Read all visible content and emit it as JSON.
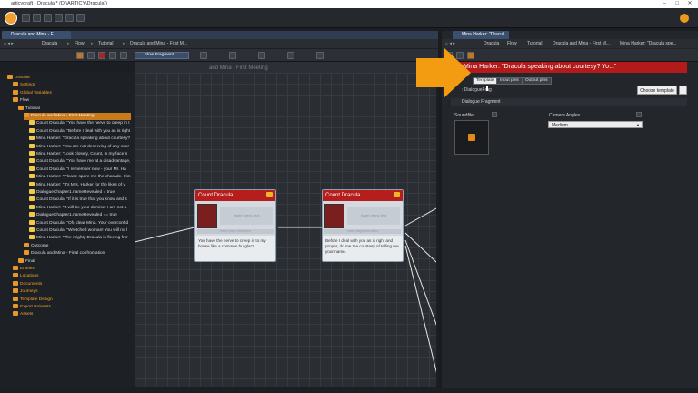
{
  "window": {
    "title": "articydraft - Dracula * (D:\\ARTICY\\Dracula\\)"
  },
  "left_panel": {
    "tab": "Dracula and Mina - F...",
    "breadcrumb": [
      "Dracula",
      "Flow",
      "Tutorial",
      "Dracula and Mina - First M..."
    ],
    "flow_fragment_label": "Flow Fragment",
    "canvas_title_partial": "and Mina - First Meeting"
  },
  "tree": [
    {
      "label": "Dracula",
      "color": "orange",
      "indent": 0
    },
    {
      "label": "Settings",
      "color": "orange",
      "indent": 1
    },
    {
      "label": "Global Variables",
      "color": "orange",
      "indent": 1
    },
    {
      "label": "Flow",
      "color": "white",
      "indent": 1
    },
    {
      "label": "Tutorial",
      "color": "white",
      "indent": 2
    },
    {
      "label": "Dracula and Mina - First Meeting",
      "color": "white",
      "indent": 3,
      "selected": true
    },
    {
      "label": "Count Dracula: \"You have the nerve to creep in t",
      "color": "white",
      "indent": 4
    },
    {
      "label": "Count Dracula: \"Before I deal with you as is right",
      "color": "white",
      "indent": 4
    },
    {
      "label": "Mina Harker: \"Dracula speaking about courtesy?",
      "color": "white",
      "indent": 4
    },
    {
      "label": "Mina Harker: \"You are not deserving of any cour",
      "color": "white",
      "indent": 4
    },
    {
      "label": "Mina Harker: \"Look closely, Count, is my face n",
      "color": "white",
      "indent": 4
    },
    {
      "label": "Count Dracula: \"You have me at a disadvantage,",
      "color": "white",
      "indent": 4
    },
    {
      "label": "Count Dracula: \"I remember now - your Mr. Ha",
      "color": "white",
      "indent": 4
    },
    {
      "label": "Mina Harker: \"Please spare me the charade. I kn",
      "color": "white",
      "indent": 4
    },
    {
      "label": "Mina Harker: \"It's Mrs. Harker for the likes of y",
      "color": "white",
      "indent": 4
    },
    {
      "label": "DialogueChapter1.nameRevealed = true",
      "color": "white",
      "indent": 4
    },
    {
      "label": "Count Dracula: \"If it is true that you know and s",
      "color": "white",
      "indent": 4
    },
    {
      "label": "Mina Harker: \"It will be your demise! I am not a",
      "color": "white",
      "indent": 4
    },
    {
      "label": "DialogueChapter1.nameRevealed == true",
      "color": "white",
      "indent": 4
    },
    {
      "label": "Count Dracula: \"Oh, dear Mina. Your overconfid",
      "color": "white",
      "indent": 4
    },
    {
      "label": "Count Dracula: \"Wretched woman! You will no l",
      "color": "white",
      "indent": 4
    },
    {
      "label": "Mina Harker: \"The mighty Dracula is fleeing fror",
      "color": "white",
      "indent": 4
    },
    {
      "label": "Outcome",
      "color": "white",
      "indent": 3
    },
    {
      "label": "Dracula and Mina - Final confrontation",
      "color": "white",
      "indent": 3
    },
    {
      "label": "Final",
      "color": "white",
      "indent": 2
    },
    {
      "label": "Entities",
      "color": "orange",
      "indent": 1
    },
    {
      "label": "Locations",
      "color": "orange",
      "indent": 1
    },
    {
      "label": "Documents",
      "color": "orange",
      "indent": 1
    },
    {
      "label": "Journeys",
      "color": "orange",
      "indent": 1
    },
    {
      "label": "Template Design",
      "color": "orange",
      "indent": 1
    },
    {
      "label": "Export Rulesets",
      "color": "orange",
      "indent": 1
    },
    {
      "label": "Assets",
      "color": "orange",
      "indent": 1
    }
  ],
  "nodes": [
    {
      "speaker": "Count Dracula",
      "menu": "Insert menu text",
      "stage": "Insert stage directions",
      "text": "You have the nerve to creep in to my house like a common burglar?"
    },
    {
      "speaker": "Count Dracula",
      "menu": "Insert menu text",
      "stage": "Insert stage directions",
      "text": "Before I deal with you as is right and proper, do me the courtesy of telling me your name."
    }
  ],
  "right_panel": {
    "tab": "Mina Harker: \"Dracul...",
    "breadcrumb": [
      "Dracula",
      "Flow",
      "Tutorial",
      "Dracula and Mina - First M...",
      "Mina Harker: \"Dracula spe..."
    ],
    "title": "Mina Harker: \"Dracula speaking about courtesy? Yo...\"",
    "tabs": [
      "Template",
      "Input pins",
      "Output pins"
    ],
    "template_value": ": DialogueFrag",
    "choose_template": "Choose template",
    "section": "Dialogue Fragment",
    "soundfile_label": "Soundfile",
    "camera_label": "Camera Angles",
    "camera_value": "Medium"
  },
  "colors": {
    "accent_orange": "#f39c12",
    "node_header": "#b61d1d",
    "title_red": "#b31a1a"
  }
}
